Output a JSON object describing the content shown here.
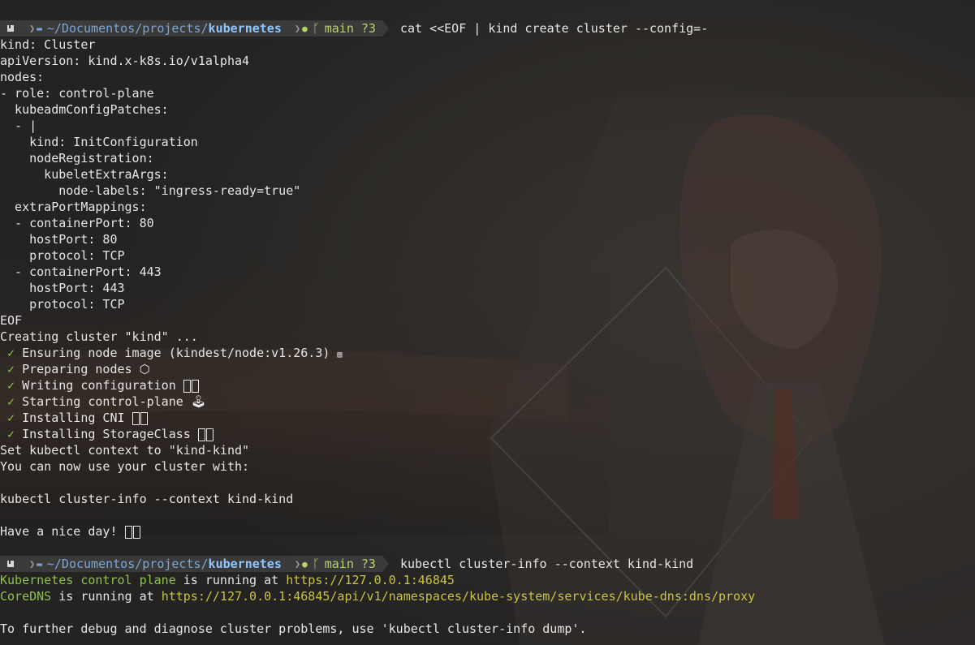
{
  "prompt1": {
    "path_prefix": "~/Documentos/projects/",
    "path_current": "kubernetes",
    "branch": "main",
    "status": "?3",
    "command": "cat <<EOF | kind create cluster --config=-"
  },
  "config_lines": [
    "kind: Cluster",
    "apiVersion: kind.x-k8s.io/v1alpha4",
    "nodes:",
    "- role: control-plane",
    "  kubeadmConfigPatches:",
    "  - |",
    "    kind: InitConfiguration",
    "    nodeRegistration:",
    "      kubeletExtraArgs:",
    "        node-labels: \"ingress-ready=true\"",
    "  extraPortMappings:",
    "  - containerPort: 80",
    "    hostPort: 80",
    "    protocol: TCP",
    "  - containerPort: 443",
    "    hostPort: 443",
    "    protocol: TCP",
    "EOF"
  ],
  "creating": "Creating cluster \"kind\" ...",
  "steps": {
    "check": "✓",
    "s1": "Ensuring node image (kindest/node:v1.26.3) ",
    "s2": "Preparing nodes ",
    "s3": "Writing configuration ",
    "s4": "Starting control-plane ",
    "s5": "Installing CNI ",
    "s6": "Installing StorageClass "
  },
  "after": {
    "context": "Set kubectl context to \"kind-kind\"",
    "use": "You can now use your cluster with:",
    "cmd": "kubectl cluster-info --context kind-kind",
    "nice": "Have a nice day! "
  },
  "prompt2": {
    "path_prefix": "~/Documentos/projects/",
    "path_current": "kubernetes",
    "branch": "main",
    "status": "?3",
    "command": "kubectl cluster-info --context kind-kind"
  },
  "info": {
    "l1_label": "Kubernetes control plane",
    "l1_mid": " is running at ",
    "l1_url": "https://127.0.0.1:46845",
    "l2_label": "CoreDNS",
    "l2_mid": " is running at ",
    "l2_url": "https://127.0.0.1:46845/api/v1/namespaces/kube-system/services/kube-dns:dns/proxy",
    "debug": "To further debug and diagnose cluster problems, use 'kubectl cluster-info dump'."
  },
  "colors": {
    "background": "#2a2927",
    "text": "#e6e6e6",
    "success": "#8bc34a",
    "url": "#c9c442",
    "path": "#7aa6d6"
  }
}
